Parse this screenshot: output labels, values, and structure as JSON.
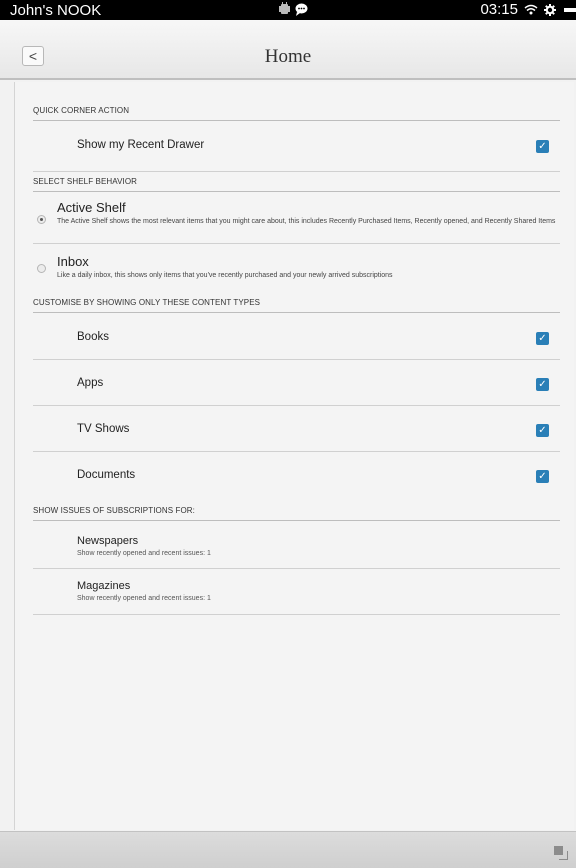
{
  "status_bar": {
    "device_name": "John's NOOK",
    "time": "03:15",
    "icons": [
      "android-debug-icon",
      "chat-bubble-icon",
      "wifi-icon",
      "settings-icon",
      "battery-icon"
    ]
  },
  "header": {
    "back_label": "<",
    "title": "Home"
  },
  "sections": {
    "quick_corner": {
      "header": "QUICK CORNER ACTION",
      "item": {
        "label": "Show my Recent Drawer",
        "checked": true
      }
    },
    "shelf_behavior": {
      "header": "SELECT SHELF BEHAVIOR",
      "options": [
        {
          "title": "Active Shelf",
          "description": "The Active Shelf shows the most relevant items that you might care about, this includes Recently Purchased Items, Recently opened, and Recently Shared Items",
          "selected": true
        },
        {
          "title": "Inbox",
          "description": "Like a daily inbox, this shows only items that you've recently purchased and your newly arrived subscriptions",
          "selected": false
        }
      ]
    },
    "content_types": {
      "header": "CUSTOMISE BY SHOWING ONLY THESE CONTENT TYPES",
      "items": [
        {
          "label": "Books",
          "checked": true
        },
        {
          "label": "Apps",
          "checked": true
        },
        {
          "label": "TV Shows",
          "checked": true
        },
        {
          "label": "Documents",
          "checked": true
        }
      ]
    },
    "subscriptions": {
      "header": "SHOW ISSUES OF SUBSCRIPTIONS FOR:",
      "items": [
        {
          "title": "Newspapers",
          "description": "Show recently opened and recent issues: 1"
        },
        {
          "title": "Magazines",
          "description": "Show recently opened and recent issues: 1"
        }
      ]
    }
  },
  "colors": {
    "checkbox": "#2a7fb7",
    "status_bar": "#000000",
    "background": "#f2f2f2"
  }
}
